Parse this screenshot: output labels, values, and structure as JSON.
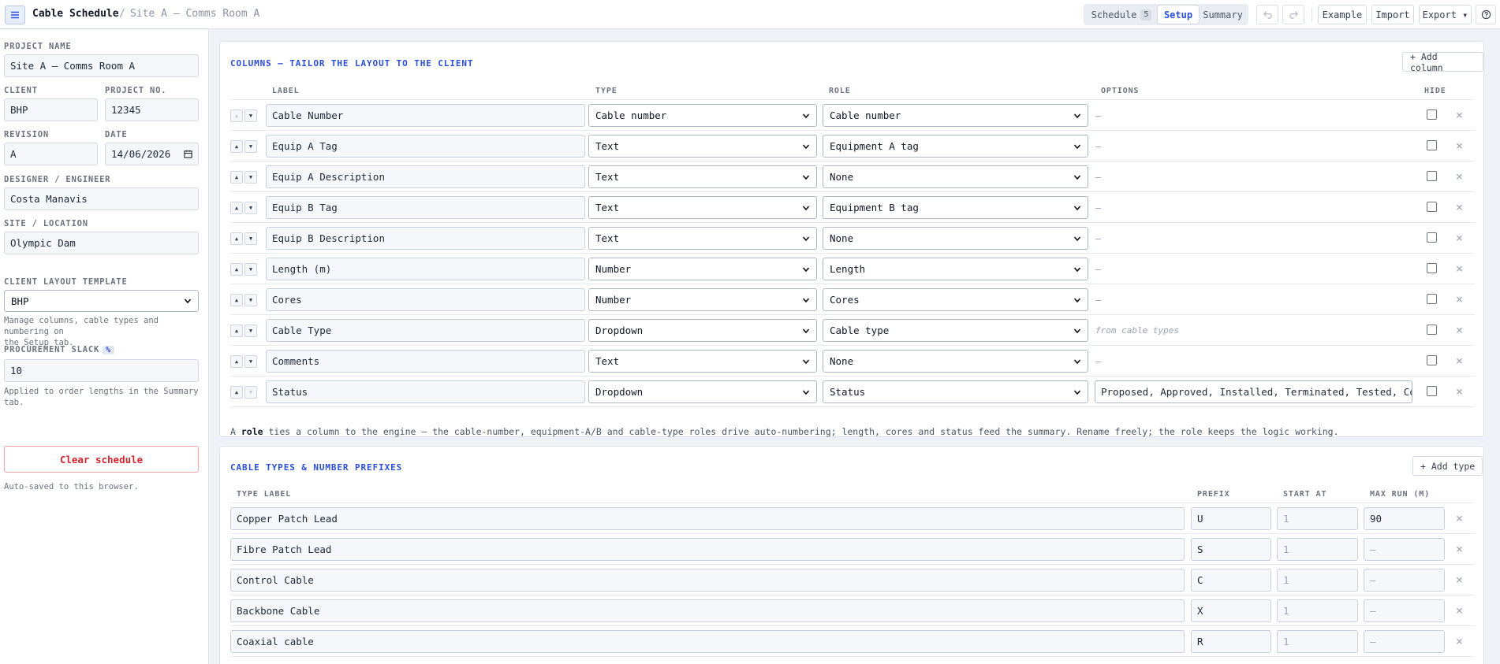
{
  "header": {
    "title": "Cable Schedule",
    "separator": "/",
    "breadcrumb": "Site A – Comms Room A",
    "tabs": [
      {
        "label": "Schedule",
        "badge": "5"
      },
      {
        "label": "Setup"
      },
      {
        "label": "Summary"
      }
    ],
    "buttons": {
      "example": "Example",
      "import": "Import",
      "export": "Export ▾"
    },
    "icons": {
      "menu": "menu-icon",
      "undo": "undo-icon",
      "redo": "redo-icon",
      "help": "help-icon"
    }
  },
  "sidebar": {
    "project_name_label": "PROJECT NAME",
    "project_name": "Site A – Comms Room A",
    "client_label": "CLIENT",
    "client": "BHP",
    "project_no_label": "PROJECT NO.",
    "project_no": "12345",
    "revision_label": "REVISION",
    "revision": "A",
    "date_label": "DATE",
    "date": "14/06/2026",
    "designer_label": "DESIGNER / ENGINEER",
    "designer": "Costa Manavis",
    "site_label": "SITE / LOCATION",
    "site": "Olympic Dam",
    "template_label": "CLIENT LAYOUT TEMPLATE",
    "template": "BHP",
    "template_hint_1": "Manage columns, cable types and numbering on",
    "template_hint_2": "the Setup tab.",
    "slack_label": "PROCUREMENT SLACK",
    "slack_unit": "%",
    "slack": "10",
    "slack_hint": "Applied to order lengths in the Summary tab.",
    "clear_label": "Clear schedule",
    "autosave": "Auto-saved to this browser."
  },
  "columns_panel": {
    "title": "COLUMNS — TAILOR THE LAYOUT TO THE CLIENT",
    "add_label": "+ Add column",
    "headers": {
      "label": "LABEL",
      "type": "TYPE",
      "role": "ROLE",
      "options": "OPTIONS",
      "hide": "HIDE"
    },
    "rows": [
      {
        "label": "Cable Number",
        "type": "Cable number",
        "role": "Cable number",
        "options": "—"
      },
      {
        "label": "Equip A Tag",
        "type": "Text",
        "role": "Equipment A tag",
        "options": "—"
      },
      {
        "label": "Equip A Description",
        "type": "Text",
        "role": "None",
        "options": "—"
      },
      {
        "label": "Equip B Tag",
        "type": "Text",
        "role": "Equipment B tag",
        "options": "—"
      },
      {
        "label": "Equip B Description",
        "type": "Text",
        "role": "None",
        "options": "—"
      },
      {
        "label": "Length (m)",
        "type": "Number",
        "role": "Length",
        "options": "—"
      },
      {
        "label": "Cores",
        "type": "Number",
        "role": "Cores",
        "options": "—"
      },
      {
        "label": "Cable Type",
        "type": "Dropdown",
        "role": "Cable type",
        "options": "from cable types"
      },
      {
        "label": "Comments",
        "type": "Text",
        "role": "None",
        "options": "—"
      },
      {
        "label": "Status",
        "type": "Dropdown",
        "role": "Status",
        "options": "Proposed, Approved, Installed, Terminated, Tested, Commiss"
      }
    ],
    "note_a": "A ",
    "note_role": "role",
    "note_b": " ties a column to the engine — the cable-number, equipment-A/B and cable-type roles drive auto-numbering; length, cores and status feed the summary. Rename freely; the role keeps the logic working."
  },
  "types_panel": {
    "title": "CABLE TYPES & NUMBER PREFIXES",
    "add_label": "+ Add type",
    "headers": {
      "label": "TYPE LABEL",
      "prefix": "PREFIX",
      "start": "START AT",
      "max": "MAX RUN (M)"
    },
    "rows": [
      {
        "label": "Copper Patch Lead",
        "prefix": "U",
        "start": "1",
        "max": "90"
      },
      {
        "label": "Fibre Patch Lead",
        "prefix": "S",
        "start": "1",
        "max": "—"
      },
      {
        "label": "Control Cable",
        "prefix": "C",
        "start": "1",
        "max": "—"
      },
      {
        "label": "Backbone Cable",
        "prefix": "X",
        "start": "1",
        "max": "—"
      },
      {
        "label": "Coaxial cable",
        "prefix": "R",
        "start": "1",
        "max": "—"
      }
    ]
  }
}
